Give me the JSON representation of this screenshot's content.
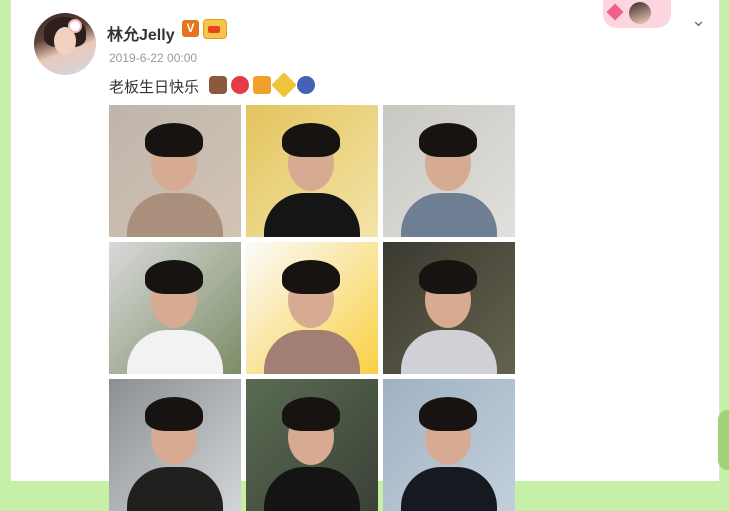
{
  "post": {
    "username": "林允Jelly",
    "verified_badge": "V",
    "timestamp": "2019-6-22 00:00",
    "text": "老板生日快乐",
    "emoji_icons": [
      "cake-icon",
      "balloon-icon",
      "gift-icon",
      "party-popper-icon",
      "trophy-icon"
    ]
  },
  "header": {
    "menu_icon": "chevron-down-icon"
  },
  "photos": [
    {
      "name": "photo-1",
      "colors": [
        "#bfb5ab",
        "#a98f7c",
        "#d2c4b4"
      ]
    },
    {
      "name": "photo-2",
      "colors": [
        "#e3c45e",
        "#151515",
        "#f3e4a8"
      ]
    },
    {
      "name": "photo-3",
      "colors": [
        "#c9c7c2",
        "#6e7e93",
        "#e1e0dc"
      ]
    },
    {
      "name": "photo-4",
      "colors": [
        "#d9d9d9",
        "#f2f2f2",
        "#7b8d66"
      ]
    },
    {
      "name": "photo-5",
      "colors": [
        "#fbfbfb",
        "#a27e73",
        "#f9d043"
      ]
    },
    {
      "name": "photo-6",
      "colors": [
        "#3b3a30",
        "#cfd1d6",
        "#64624f"
      ]
    },
    {
      "name": "photo-7",
      "colors": [
        "#8b8f91",
        "#20211f",
        "#d1d5d8"
      ]
    },
    {
      "name": "photo-8",
      "colors": [
        "#5a6b53",
        "#141414",
        "#3a4236"
      ]
    },
    {
      "name": "photo-9",
      "colors": [
        "#9fb1c2",
        "#161a20",
        "#c3d0dc"
      ]
    }
  ]
}
